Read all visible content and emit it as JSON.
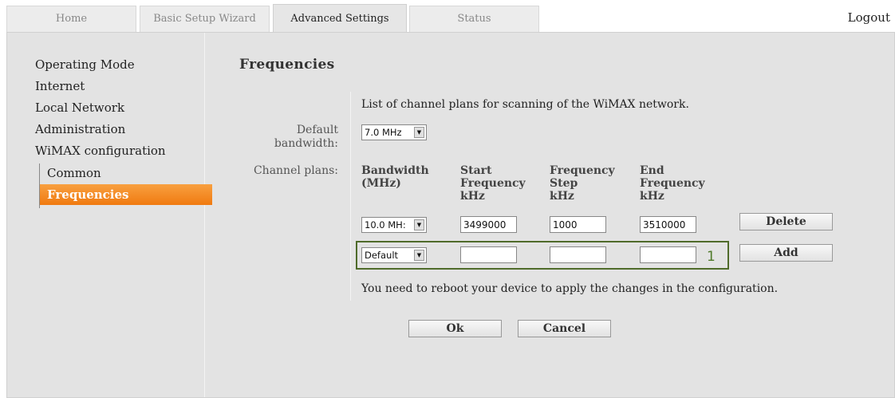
{
  "tabs": [
    {
      "label": "Home",
      "active": false
    },
    {
      "label": "Basic Setup Wizard",
      "active": false
    },
    {
      "label": "Advanced Settings",
      "active": true
    },
    {
      "label": "Status",
      "active": false
    }
  ],
  "logout": "Logout",
  "sidebar": {
    "items": [
      "Operating Mode",
      "Internet",
      "Local Network",
      "Administration",
      "WiMAX configuration"
    ],
    "subitems": [
      {
        "label": "Common",
        "active": false
      },
      {
        "label": "Frequencies",
        "active": true
      }
    ]
  },
  "page": {
    "title": "Frequencies",
    "intro": "List of channel plans for scanning of the WiMAX network.",
    "default_bandwidth_label": "Default bandwidth:",
    "default_bandwidth_value": "7.0 MHz",
    "channel_plans_label": "Channel plans:",
    "columns": [
      {
        "l1": "Bandwidth",
        "l2": "(MHz)",
        "l3": ""
      },
      {
        "l1": "Start",
        "l2": "Frequency",
        "l3": "kHz"
      },
      {
        "l1": "Frequency",
        "l2": "Step",
        "l3": "kHz"
      },
      {
        "l1": "End",
        "l2": "Frequency",
        "l3": "kHz"
      }
    ],
    "rows": [
      {
        "bandwidth": "10.0 MH:",
        "start": "3499000",
        "step": "1000",
        "end": "3510000",
        "button": "Delete"
      },
      {
        "bandwidth": "Default",
        "start": "",
        "step": "",
        "end": "",
        "button": "Add"
      }
    ],
    "highlight_number": "1",
    "note": "You need to reboot your device to apply the changes in the configuration.",
    "ok_label": "Ok",
    "cancel_label": "Cancel"
  },
  "colors": {
    "accent_orange": "#f07a10",
    "highlight_green": "#4f6b2a"
  }
}
